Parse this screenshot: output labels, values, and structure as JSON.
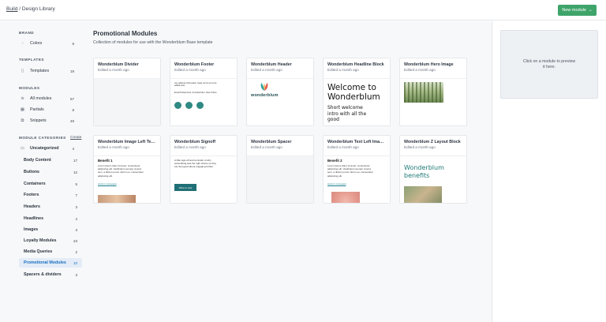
{
  "breadcrumb": {
    "root": "Build",
    "separator": " / ",
    "current": "Design Library"
  },
  "new_module_button": {
    "label": "New module",
    "icon": "chevron-down-icon"
  },
  "sidebar": {
    "brand_label": "BRAND",
    "brand_items": [
      {
        "label": "Colors",
        "count": "8",
        "icon": "palette-icon"
      }
    ],
    "templates_label": "TEMPLATES",
    "templates_items": [
      {
        "label": "Templates",
        "count": "19",
        "icon": "document-icon"
      }
    ],
    "modules_label": "MODULES",
    "modules_items": [
      {
        "label": "All modules",
        "count": "57",
        "icon": "stack-icon"
      },
      {
        "label": "Partials",
        "count": "8",
        "icon": "grid-icon"
      },
      {
        "label": "Snippets",
        "count": "49",
        "icon": "copy-icon"
      }
    ],
    "categories_label": "MODULE CATEGORIES",
    "create_label": "Create",
    "categories": [
      {
        "label": "Uncategorized",
        "count": "4"
      },
      {
        "label": "Body Content",
        "count": "17"
      },
      {
        "label": "Buttons",
        "count": "12"
      },
      {
        "label": "Containers",
        "count": "5"
      },
      {
        "label": "Footers",
        "count": "7"
      },
      {
        "label": "Headers",
        "count": "3"
      },
      {
        "label": "Headlines",
        "count": "4"
      },
      {
        "label": "Images",
        "count": "3"
      },
      {
        "label": "Loyalty Modules",
        "count": "23"
      },
      {
        "label": "Media Queries",
        "count": "2"
      },
      {
        "label": "Promotional Modules",
        "count": "10"
      },
      {
        "label": "Spacers & dividers",
        "count": "3"
      }
    ],
    "active_category": "Promotional Modules"
  },
  "main": {
    "title": "Promotional Modules",
    "subtitle": "Collection of modules for use with the Wonderblum Base template",
    "edited": "Edited a month ago",
    "cards": [
      {
        "name": "Wonderblum Divider"
      },
      {
        "name": "Wonderblum Footer",
        "preview": {
          "address": "Any address information, legal, terms etc to be added here.",
          "links": "Email Preferences  |  Unsubscribe  |  View Online"
        }
      },
      {
        "name": "Wonderblum Header",
        "preview": {
          "logo": "wonderblum"
        }
      },
      {
        "name": "Wonderblum Headline Block",
        "preview": {
          "headline": "Welcome to Wonderblum",
          "body": "Short welcome intro with all the good"
        }
      },
      {
        "name": "Wonderblum Hero Image"
      },
      {
        "name": "Wonderblum Image Left Text ...",
        "preview": {
          "heading": "Benefit 1",
          "body": "Lorem ipsum dolor sit amet, consectetur adipiscing elit. Vestibulum semper viverra sem, a dictum purus rutrum eu, consectetur adipiscing elit.",
          "link": "turpis in consequat"
        }
      },
      {
        "name": "Wonderblum Signoff",
        "preview": {
          "body": "A little sign-off and reminder of why subscribing was the right choice so they can feel good about engaging further.",
          "button": "Write to web"
        }
      },
      {
        "name": "Wonderblum Spacer"
      },
      {
        "name": "Wonderblum Text Left Image ...",
        "preview": {
          "heading": "Benefit 2",
          "body": "Lorem ipsum dolor sit amet, consectetur adipiscing elit. Vestibulum semper viverra sem, a dictum purus rutrum eu, consectetur adipiscing elit.",
          "link": "turpis in consequat"
        }
      },
      {
        "name": "Wonderblum Z Layout Block",
        "preview": {
          "headline": "Wonderblum benefits"
        }
      }
    ]
  },
  "preview_panel": {
    "placeholder": "Click on a module to preview it here."
  },
  "colors": {
    "accent": "#3fa46a",
    "active": "#1a6fbf",
    "brand_teal": "#1f7a77"
  }
}
